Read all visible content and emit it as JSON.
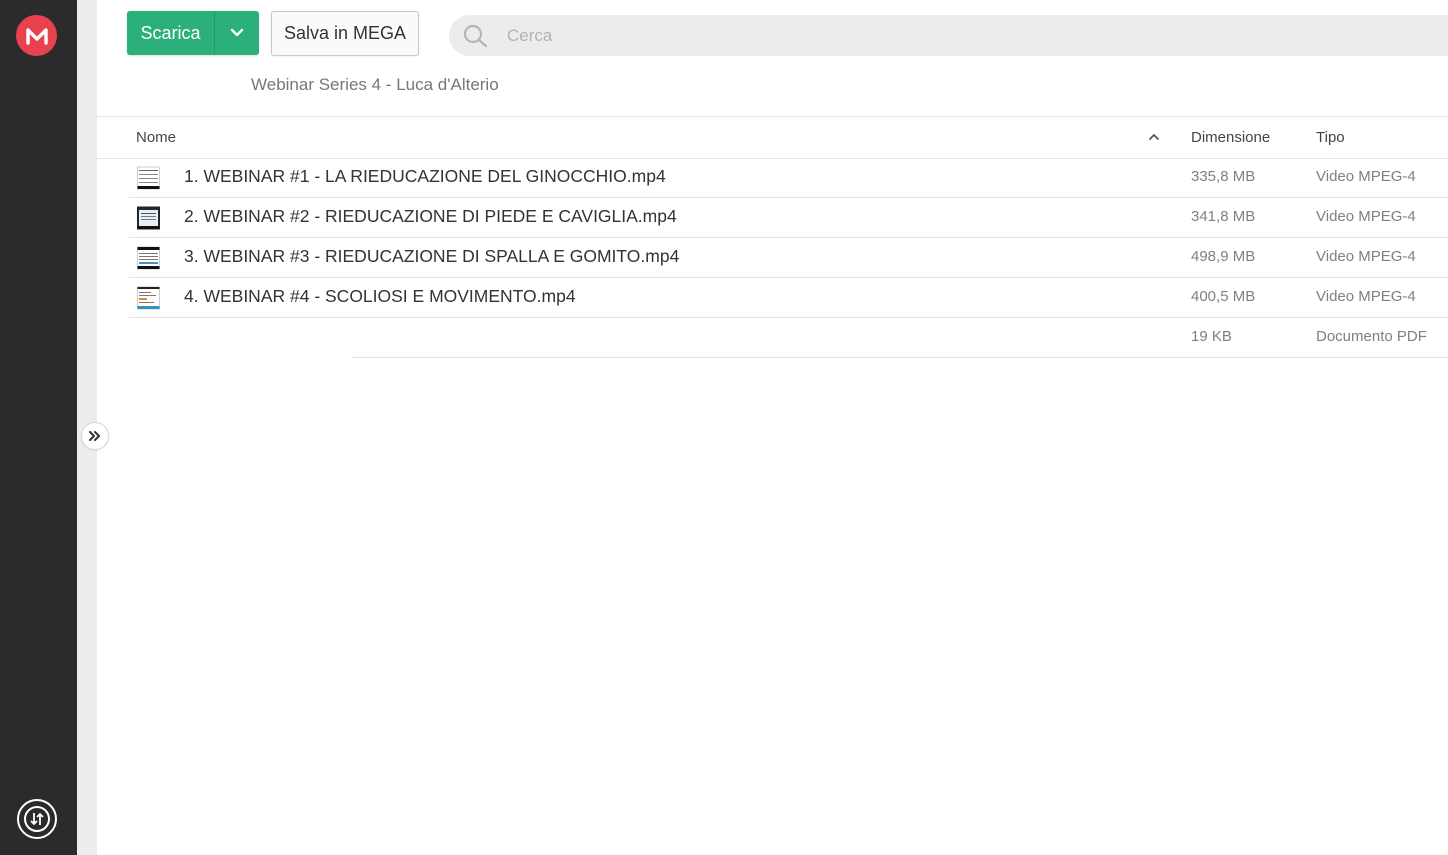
{
  "toolbar": {
    "download_label": "Scarica",
    "save_label": "Salva in MEGA"
  },
  "search": {
    "placeholder": "Cerca"
  },
  "breadcrumb": "Webinar Series 4 - Luca d'Alterio",
  "table": {
    "headers": {
      "name": "Nome",
      "size": "Dimensione",
      "type": "Tipo"
    },
    "rows": [
      {
        "name": "1. WEBINAR #1 - LA RIEDUCAZIONE DEL GINOCCHIO.mp4",
        "size": "335,8 MB",
        "type": "Video MPEG-4"
      },
      {
        "name": "2. WEBINAR #2 - RIEDUCAZIONE DI PIEDE E CAVIGLIA.mp4",
        "size": "341,8 MB",
        "type": "Video MPEG-4"
      },
      {
        "name": "3. WEBINAR #3 - RIEDUCAZIONE DI SPALLA E GOMITO.mp4",
        "size": "498,9 MB",
        "type": "Video MPEG-4"
      },
      {
        "name": "4. WEBINAR #4 - SCOLIOSI E MOVIMENTO.mp4",
        "size": "400,5 MB",
        "type": "Video MPEG-4"
      },
      {
        "name": "",
        "size": "19 KB",
        "type": "Documento PDF"
      }
    ]
  },
  "icons": {
    "logo": "mega-logo-icon",
    "transfers": "transfer-manager-icon",
    "expand": "double-chevron-right-icon",
    "search": "search-icon",
    "sort": "chevron-up-icon",
    "dropdown": "chevron-down-icon",
    "file": "video-thumbnail-icon"
  },
  "colors": {
    "accent_green": "#2bb07b",
    "brand_red": "#e9424f",
    "rail_dark": "#2b2b2b"
  }
}
